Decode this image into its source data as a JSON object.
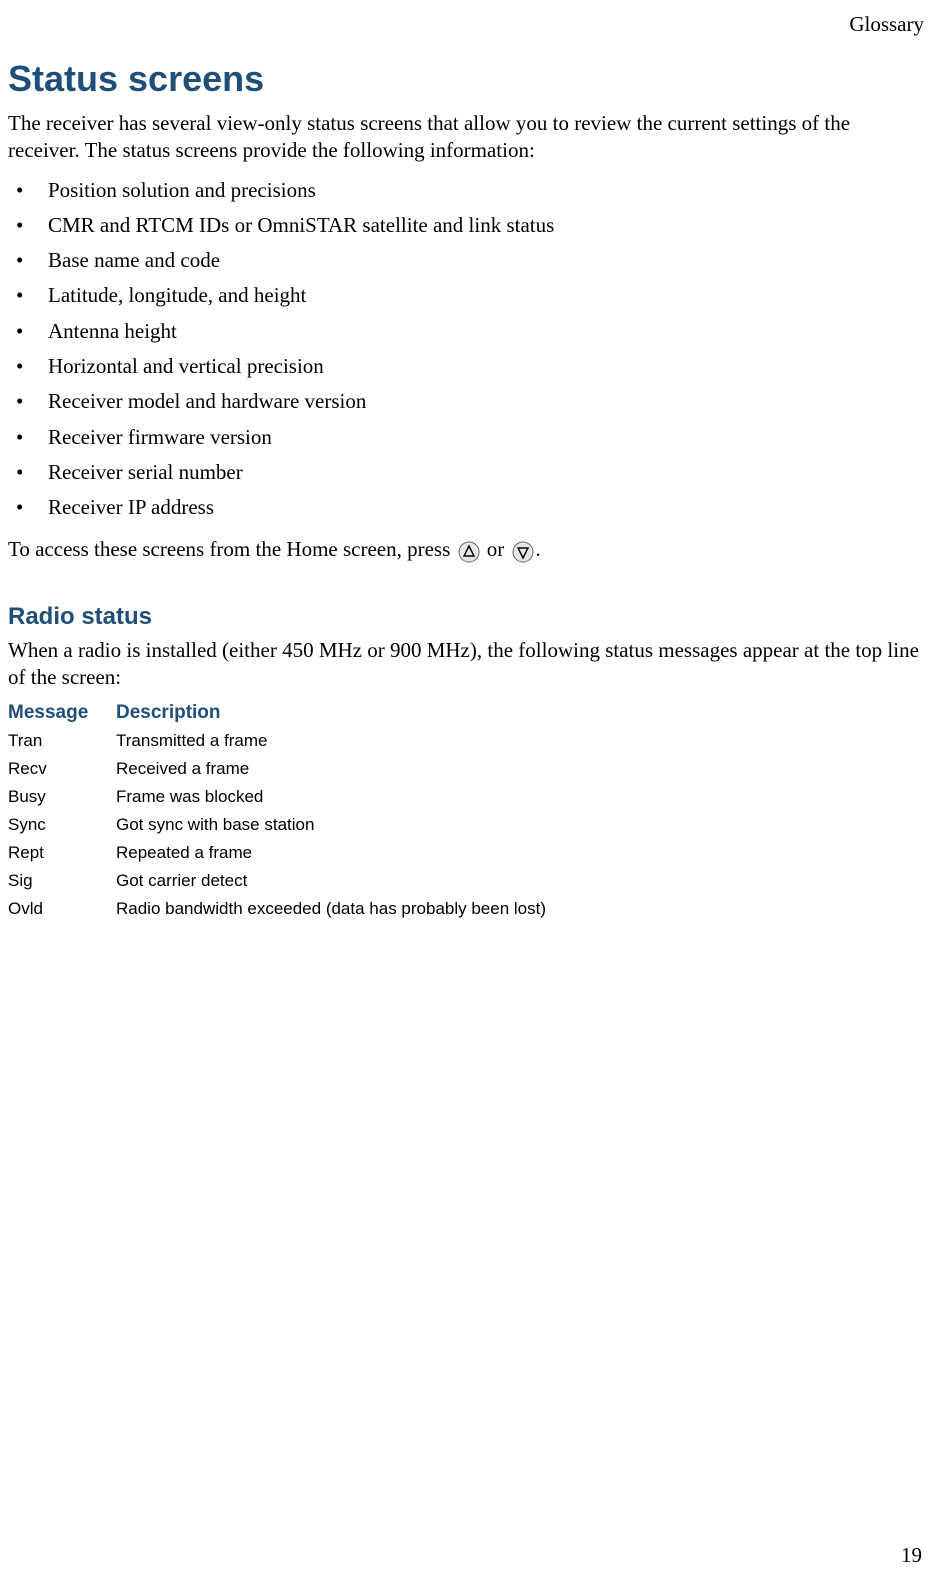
{
  "header": {
    "section_label": "Glossary"
  },
  "main": {
    "title": "Status screens",
    "intro": "The receiver has several view-only status screens that allow you to review the current settings of the receiver. The status screens provide the following information:",
    "bullets": [
      "Position solution and precisions",
      "CMR and RTCM IDs or OmniSTAR satellite and link status",
      "Base name and code",
      "Latitude, longitude, and height",
      "Antenna height",
      "Horizontal and vertical precision",
      "Receiver model and hardware version",
      "Receiver firmware version",
      "Receiver serial number",
      "Receiver IP address"
    ],
    "access_prefix": "To access these screens from the Home screen, press",
    "access_or": "or",
    "access_suffix": "."
  },
  "radio": {
    "heading": "Radio status",
    "intro": "When a radio is installed (either 450 MHz or 900 MHz), the following status messages appear at the top line of the screen:",
    "table": {
      "headers": {
        "message": "Message",
        "description": "Description"
      },
      "rows": [
        {
          "message": "Tran",
          "description": "Transmitted a frame"
        },
        {
          "message": "Recv",
          "description": "Received a frame"
        },
        {
          "message": "Busy",
          "description": "Frame was blocked"
        },
        {
          "message": "Sync",
          "description": "Got sync with base station"
        },
        {
          "message": "Rept",
          "description": "Repeated a frame"
        },
        {
          "message": "Sig",
          "description": "Got carrier detect"
        },
        {
          "message": "Ovld",
          "description": "Radio bandwidth exceeded (data has probably been lost)"
        }
      ]
    }
  },
  "footer": {
    "page_number": "19"
  }
}
